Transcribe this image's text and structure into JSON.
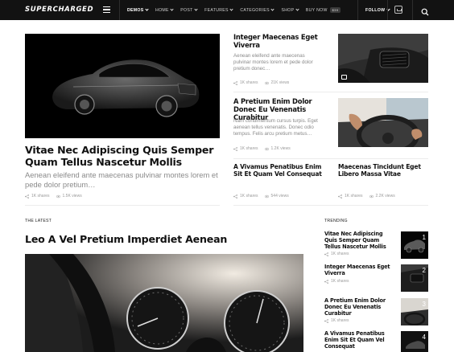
{
  "header": {
    "logo": "SUPERCHARGED",
    "nav": [
      {
        "label": "DEMOS",
        "active": true,
        "chevron": true
      },
      {
        "label": "HOME",
        "chevron": true
      },
      {
        "label": "POST",
        "chevron": true
      },
      {
        "label": "FEATURES",
        "chevron": true
      },
      {
        "label": "CATEGORIES",
        "chevron": true
      },
      {
        "label": "SHOP",
        "chevron": true
      },
      {
        "label": "BUY NOW",
        "badge": "$39"
      }
    ],
    "follow_label": "FOLLOW",
    "icons": [
      "menu-icon",
      "subscribe-icon",
      "search-icon"
    ]
  },
  "featured": {
    "title": "Vitae Nec Adipiscing Quis Semper Quam Tellus Nascetur Mollis",
    "excerpt": "Aenean eleifend ante maecenas pulvinar montes lorem et pede dolor pretium…",
    "shares": "1K shares",
    "views": "1.5K views"
  },
  "side_posts": [
    {
      "title": "Integer Maecenas Eget Viverra",
      "excerpt": "Aenean eleifend ante maecenas pulvinar montes lorem et pede dolor pretium donec…",
      "shares": "1K shares",
      "views": "21K views"
    },
    {
      "title": "A Pretium Enim Dolor Donec Eu Venenatis Curabitur",
      "excerpt": "Nam condimentum cursus turpis. Eget aenean tellus venenatis. Donec odio tempus. Felis arcu pretium metus…",
      "shares": "1K shares",
      "views": "1.2K views"
    }
  ],
  "bottom_posts": [
    {
      "title": "A Vivamus Penatibus Enim Sit Et Quam Vel Consequat",
      "shares": "1K shares",
      "views": "544 views"
    },
    {
      "title": "Maecenas Tincidunt Eget Libero Massa Vitae",
      "shares": "1K shares",
      "views": "2.2K views"
    }
  ],
  "latest": {
    "section_label": "THE LATEST",
    "title": "Leo A Vel Pretium Imperdiet Aenean"
  },
  "trending": {
    "section_label": "TRENDING",
    "items": [
      {
        "title": "Vitae Nec Adipiscing Quis Semper Quam Tellus Nascetur Mollis",
        "shares": "1K shares",
        "number": "1"
      },
      {
        "title": "Integer Maecenas Eget Viverra",
        "shares": "1K shares",
        "number": "2"
      },
      {
        "title": "A Pretium Enim Dolor Donec Eu Venenatis Curabitur",
        "shares": "1K shares",
        "number": "3"
      },
      {
        "title": "A Vivamus Penatibus Enim Sit Et Quam Vel Consequat",
        "shares": "",
        "number": "4"
      }
    ]
  },
  "colors": {
    "header_bg": "#121212",
    "text": "#111111",
    "muted": "#8a8a8a"
  }
}
